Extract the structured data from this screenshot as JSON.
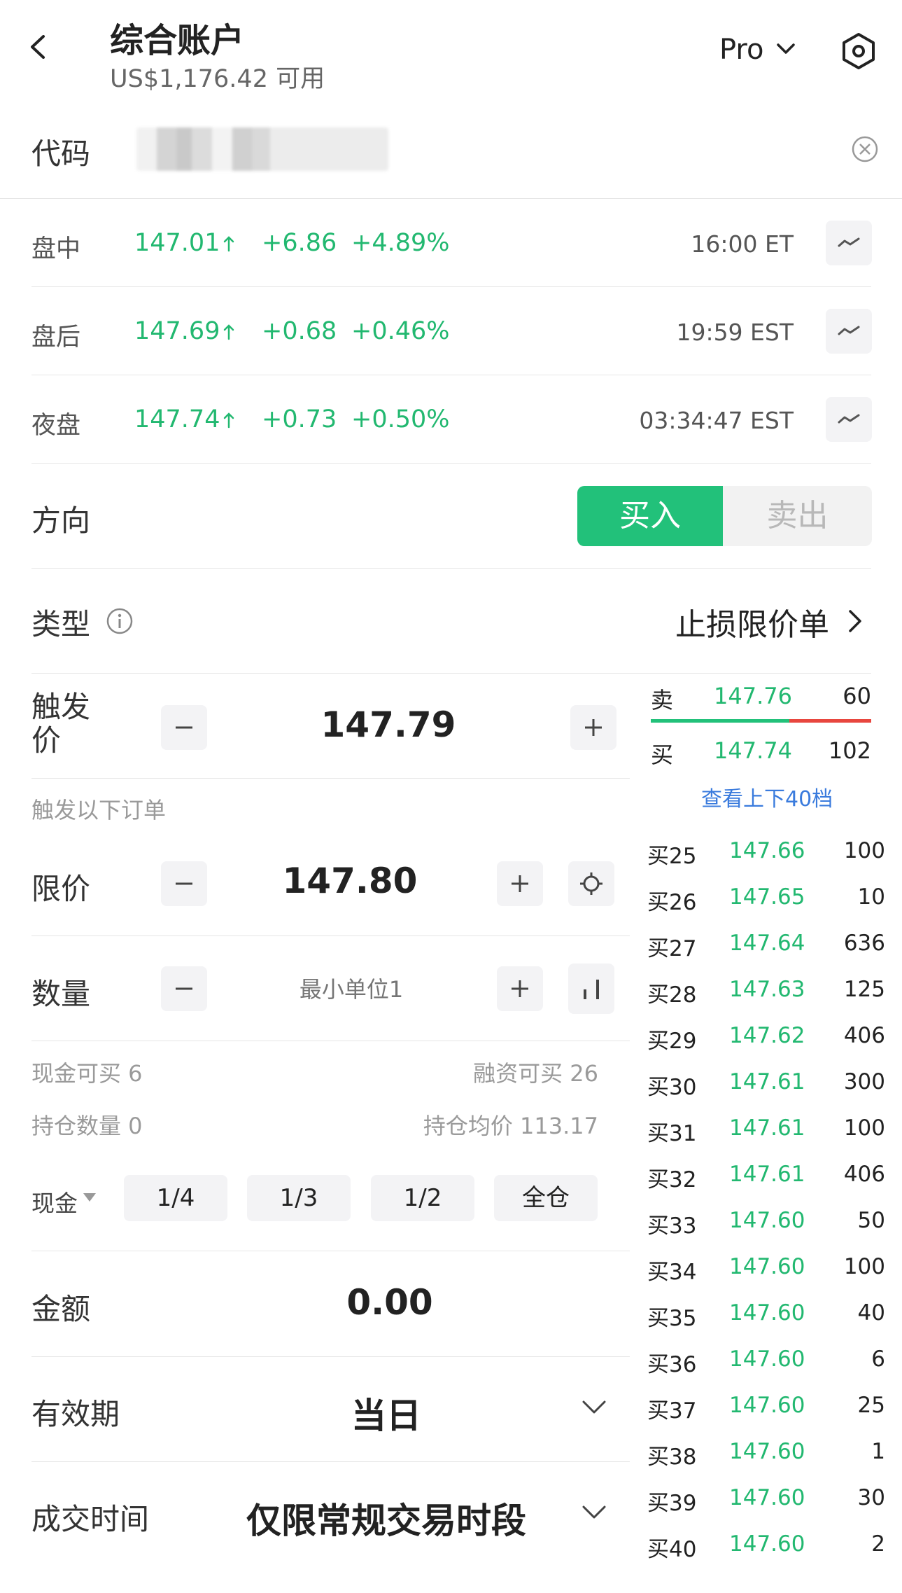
{
  "header": {
    "title": "综合账户",
    "subtitle": "US$1,176.42 可用",
    "mode": "Pro"
  },
  "code": {
    "label": "代码"
  },
  "quotes": [
    {
      "label": "盘中",
      "price": "147.01",
      "change": "+6.86",
      "pct": "+4.89%",
      "time": "16:00 ET"
    },
    {
      "label": "盘后",
      "price": "147.69",
      "change": "+0.68",
      "pct": "+0.46%",
      "time": "19:59 EST"
    },
    {
      "label": "夜盘",
      "price": "147.74",
      "change": "+0.73",
      "pct": "+0.50%",
      "time": "03:34:47 EST"
    }
  ],
  "direction": {
    "label": "方向",
    "buy": "买入",
    "sell": "卖出"
  },
  "order_type": {
    "label": "类型",
    "value": "止损限价单"
  },
  "trigger": {
    "label_line1": "触发",
    "label_line2": "价",
    "value": "147.79",
    "hint": "触发以下订单"
  },
  "limit": {
    "label": "限价",
    "value": "147.80"
  },
  "quantity": {
    "label": "数量",
    "placeholder": "最小单位1"
  },
  "availability": {
    "cash_buy": "现金可买 6",
    "margin_buy": "融资可买 26",
    "position_qty": "持仓数量 0",
    "avg_cost": "持仓均价 113.17"
  },
  "fractions": {
    "account": "现金",
    "options": [
      "1/4",
      "1/3",
      "1/2",
      "全仓"
    ]
  },
  "amount": {
    "label": "金额",
    "value": "0.00"
  },
  "validity": {
    "label": "有效期",
    "value": "当日"
  },
  "session": {
    "label": "成交时间",
    "value": "仅限常规交易时段"
  },
  "order_book": {
    "ask": {
      "label": "卖",
      "price": "147.76",
      "qty": "60"
    },
    "bid": {
      "label": "买",
      "price": "147.74",
      "qty": "102"
    },
    "ratio_bid": 0.63,
    "depth_link": "查看上下40档",
    "levels": [
      {
        "name": "买25",
        "price": "147.66",
        "qty": "100"
      },
      {
        "name": "买26",
        "price": "147.65",
        "qty": "10"
      },
      {
        "name": "买27",
        "price": "147.64",
        "qty": "636"
      },
      {
        "name": "买28",
        "price": "147.63",
        "qty": "125"
      },
      {
        "name": "买29",
        "price": "147.62",
        "qty": "406"
      },
      {
        "name": "买30",
        "price": "147.61",
        "qty": "300"
      },
      {
        "name": "买31",
        "price": "147.61",
        "qty": "100"
      },
      {
        "name": "买32",
        "price": "147.61",
        "qty": "406"
      },
      {
        "name": "买33",
        "price": "147.60",
        "qty": "50"
      },
      {
        "name": "买34",
        "price": "147.60",
        "qty": "100"
      },
      {
        "name": "买35",
        "price": "147.60",
        "qty": "40"
      },
      {
        "name": "买36",
        "price": "147.60",
        "qty": "6"
      },
      {
        "name": "买37",
        "price": "147.60",
        "qty": "25"
      },
      {
        "name": "买38",
        "price": "147.60",
        "qty": "1"
      },
      {
        "name": "买39",
        "price": "147.60",
        "qty": "30"
      },
      {
        "name": "买40",
        "price": "147.60",
        "qty": "2"
      }
    ]
  },
  "colors": {
    "up": "#22b870",
    "buy": "#22c17a",
    "ask_bar": "#e8463e",
    "link": "#3a7bdd"
  }
}
